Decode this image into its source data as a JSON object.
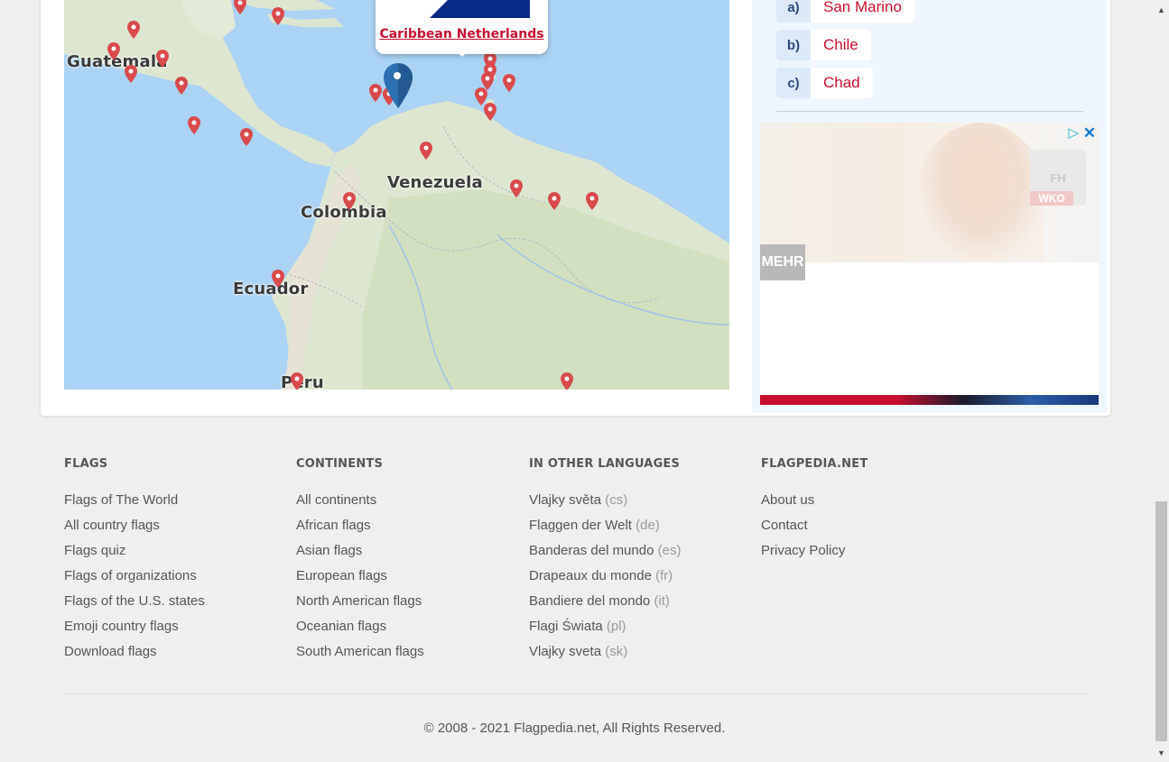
{
  "map": {
    "country_labels": [
      "Guatemala",
      "Venezuela",
      "Colombia",
      "Ecuador",
      "Peru"
    ],
    "popup_link": "Caribbean Netherlands",
    "colors": {
      "water": "#aad3f5",
      "land": "#dde7cf",
      "pin": "#d94a4a",
      "selected_pin": "#2d6fb0"
    }
  },
  "quiz": {
    "answers": [
      {
        "letter": "a)",
        "name": "San Marino"
      },
      {
        "letter": "b)",
        "name": "Chile"
      },
      {
        "letter": "c)",
        "name": "Chad"
      }
    ]
  },
  "ad": {
    "logo_text": "FH",
    "wko_text": "WKO",
    "mehr_text": "MEHR",
    "close_icon": "close-icon",
    "play_icon": "adchoices-icon"
  },
  "footer": {
    "flags": {
      "heading": "FLAGS",
      "links": [
        "Flags of The World",
        "All country flags",
        "Flags quiz",
        "Flags of organizations",
        "Flags of the U.S. states",
        "Emoji country flags",
        "Download flags"
      ]
    },
    "continents": {
      "heading": "CONTINENTS",
      "links": [
        "All continents",
        "African flags",
        "Asian flags",
        "European flags",
        "North American flags",
        "Oceanian flags",
        "South American flags"
      ]
    },
    "languages": {
      "heading": "IN OTHER LANGUAGES",
      "links": [
        {
          "text": "Vlajky světa",
          "code": "(cs)"
        },
        {
          "text": "Flaggen der Welt",
          "code": "(de)"
        },
        {
          "text": "Banderas del mundo",
          "code": "(es)"
        },
        {
          "text": "Drapeaux du monde",
          "code": "(fr)"
        },
        {
          "text": "Bandiere del mondo",
          "code": "(it)"
        },
        {
          "text": "Flagi Świata",
          "code": "(pl)"
        },
        {
          "text": "Vlajky sveta",
          "code": "(sk)"
        }
      ]
    },
    "site": {
      "heading": "FLAGPEDIA.NET",
      "links": [
        "About us",
        "Contact",
        "Privacy Policy"
      ]
    },
    "copyright": "© 2008 - 2021 Flagpedia.net, All Rights Reserved."
  }
}
